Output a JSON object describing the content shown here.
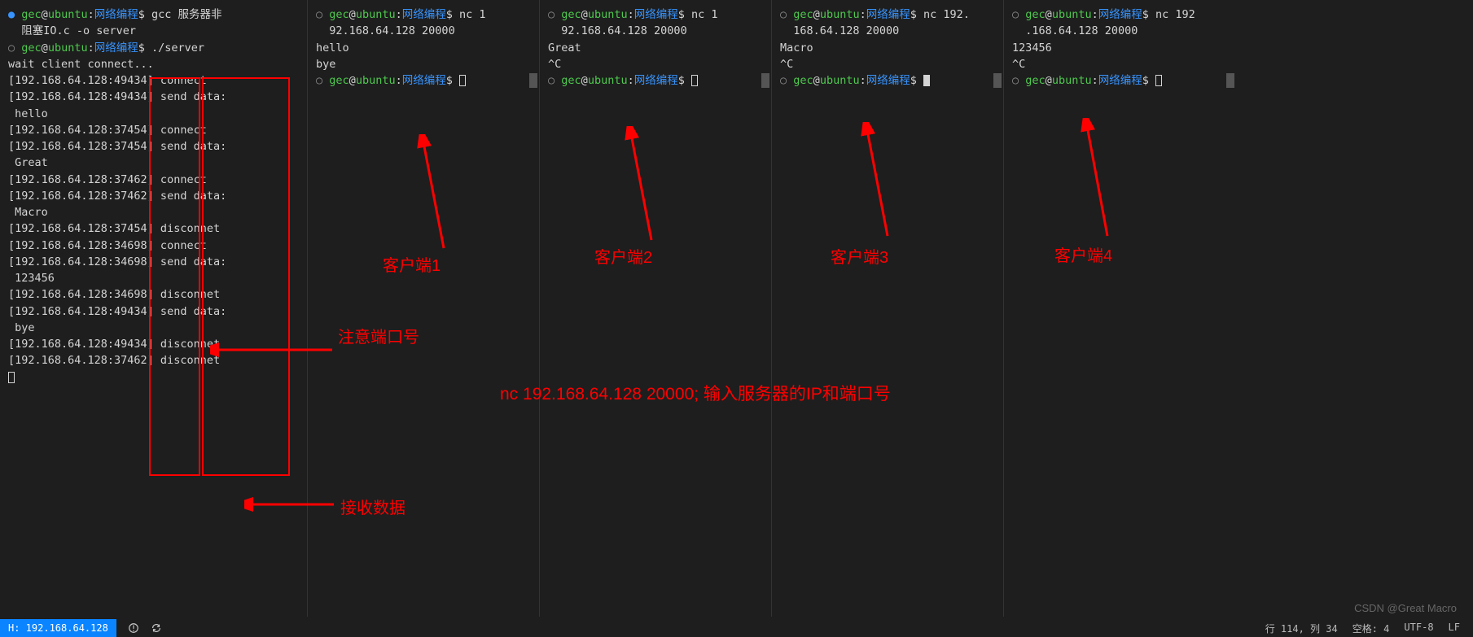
{
  "prompt": {
    "user": "gec",
    "at": "@",
    "host": "ubuntu",
    "colon": ":",
    "path": "网络编程",
    "dollar": "$"
  },
  "pane1": {
    "cmd1": " gcc 服务器非",
    "cmd1b": "阻塞IO.c -o server",
    "cmd2": " ./server",
    "lines": [
      "wait client connect...",
      "[192.168.64.128:49434] connect",
      "[192.168.64.128:49434] send data:",
      " hello",
      "",
      "[192.168.64.128:37454] connect",
      "[192.168.64.128:37454] send data:",
      " Great",
      "",
      "[192.168.64.128:37462] connect",
      "[192.168.64.128:37462] send data:",
      " Macro",
      "",
      "[192.168.64.128:37454] disconnet",
      "[192.168.64.128:34698] connect",
      "[192.168.64.128:34698] send data:",
      " 123456",
      "",
      "[192.168.64.128:34698] disconnet",
      "[192.168.64.128:49434] send data:",
      " bye",
      "",
      "[192.168.64.128:49434] disconnet",
      "[192.168.64.128:37462] disconnet"
    ]
  },
  "pane2": {
    "cmd_a": " nc 1",
    "cmd_b": "92.168.64.128 20000",
    "lines": [
      "hello",
      "bye",
      ""
    ]
  },
  "pane3": {
    "cmd_a": " nc 1",
    "cmd_b": "92.168.64.128 20000",
    "lines": [
      "Great",
      "^C"
    ]
  },
  "pane4": {
    "cmd_a": " nc 192.",
    "cmd_b": "168.64.128 20000",
    "lines": [
      "Macro",
      "^C"
    ]
  },
  "pane5": {
    "cmd_a": " nc 192",
    "cmd_b": ".168.64.128 20000",
    "lines": [
      "123456",
      "^C"
    ]
  },
  "annotations": {
    "client1": "客户端1",
    "client2": "客户端2",
    "client3": "客户端3",
    "client4": "客户端4",
    "port_note": "注意端口号",
    "nc_note": "nc 192.168.64.128 20000; 输入服务器的IP和端口号",
    "recv_note": "接收数据"
  },
  "statusbar": {
    "host_ip": "H: 192.168.64.128",
    "line_col": "行 114,  列 34",
    "spaces": "空格: 4",
    "encoding": "UTF-8",
    "eol": "LF"
  },
  "watermark": "CSDN @Great Macro"
}
